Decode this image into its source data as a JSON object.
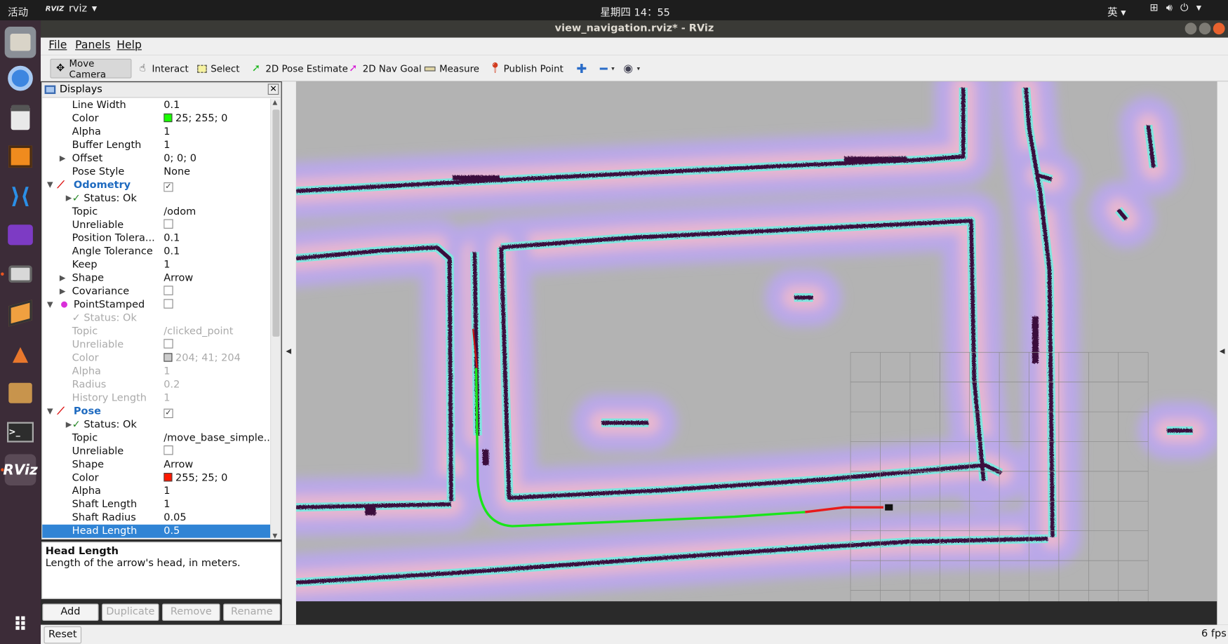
{
  "system": {
    "activities": "活动",
    "app_menu": "rviz",
    "app_badge": "RVIZ",
    "clock": "星期四 14：55",
    "ime": "英"
  },
  "window": {
    "title": "view_navigation.rviz* - RViz"
  },
  "menu": {
    "file": "File",
    "panels": "Panels",
    "help": "Help"
  },
  "toolbar": {
    "move_camera": "Move Camera",
    "interact": "Interact",
    "select": "Select",
    "pose_estimate": "2D Pose Estimate",
    "nav_goal": "2D Nav Goal",
    "measure": "Measure",
    "publish_point": "Publish Point"
  },
  "displays": {
    "title": "Displays",
    "rows": [
      {
        "k": "Line Width",
        "v": "0.1"
      },
      {
        "k": "Color",
        "v": "25; 255; 0",
        "swatch": "#19ff00"
      },
      {
        "k": "Alpha",
        "v": "1"
      },
      {
        "k": "Buffer Length",
        "v": "1"
      },
      {
        "k": "Offset",
        "v": "0; 0; 0"
      },
      {
        "k": "Pose Style",
        "v": "None"
      },
      {
        "k": "Odometry",
        "v": ""
      },
      {
        "k": "Status: Ok",
        "v": ""
      },
      {
        "k": "Topic",
        "v": "/odom"
      },
      {
        "k": "Unreliable",
        "v": ""
      },
      {
        "k": "Position Tolera...",
        "v": "0.1"
      },
      {
        "k": "Angle Tolerance",
        "v": "0.1"
      },
      {
        "k": "Keep",
        "v": "1"
      },
      {
        "k": "Shape",
        "v": "Arrow"
      },
      {
        "k": "Covariance",
        "v": ""
      },
      {
        "k": "PointStamped",
        "v": ""
      },
      {
        "k": "Status: Ok",
        "v": ""
      },
      {
        "k": "Topic",
        "v": "/clicked_point"
      },
      {
        "k": "Unreliable",
        "v": ""
      },
      {
        "k": "Color",
        "v": "204; 41; 204",
        "swatch": "#cccccc"
      },
      {
        "k": "Alpha",
        "v": "1"
      },
      {
        "k": "Radius",
        "v": "0.2"
      },
      {
        "k": "History Length",
        "v": "1"
      },
      {
        "k": "Pose",
        "v": ""
      },
      {
        "k": "Status: Ok",
        "v": ""
      },
      {
        "k": "Topic",
        "v": "/move_base_simple..."
      },
      {
        "k": "Unreliable",
        "v": ""
      },
      {
        "k": "Shape",
        "v": "Arrow"
      },
      {
        "k": "Color",
        "v": "255; 25; 0",
        "swatch": "#ff1900"
      },
      {
        "k": "Alpha",
        "v": "1"
      },
      {
        "k": "Shaft Length",
        "v": "1"
      },
      {
        "k": "Shaft Radius",
        "v": "0.05"
      },
      {
        "k": "Head Length",
        "v": "0.5"
      }
    ]
  },
  "help": {
    "title": "Head Length",
    "text": "Length of the arrow's head, in meters."
  },
  "buttons": {
    "add": "Add",
    "duplicate": "Duplicate",
    "remove": "Remove",
    "rename": "Rename",
    "reset": "Reset"
  },
  "status": {
    "fps": "6 fps"
  },
  "colors": {
    "path": "#19e619",
    "goal_arrow": "#e81919",
    "wall": "#3b0e3e",
    "inflation_edge": "#7fe6e0",
    "cost": "#b9a8e8",
    "background": "#b3b3b3"
  }
}
